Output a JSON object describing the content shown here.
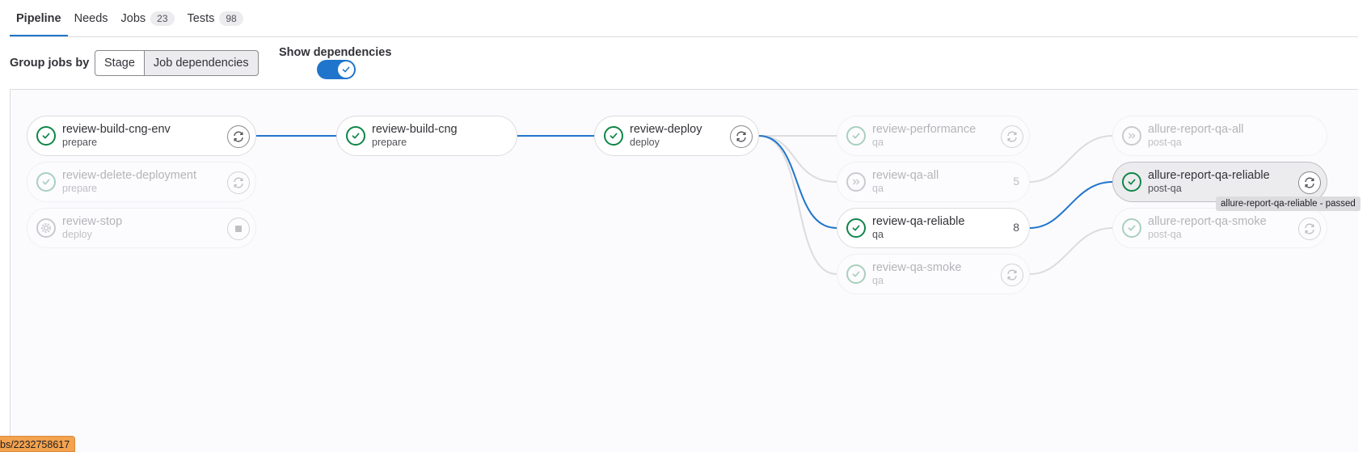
{
  "tabs": [
    {
      "label": "Pipeline",
      "badge": null
    },
    {
      "label": "Needs",
      "badge": null
    },
    {
      "label": "Jobs",
      "badge": "23"
    },
    {
      "label": "Tests",
      "badge": "98"
    }
  ],
  "controls": {
    "group_by_label": "Group jobs by",
    "group_by_options": [
      "Stage",
      "Job dependencies"
    ],
    "selected_group_by": "Job dependencies",
    "show_dependencies_label": "Show dependencies",
    "show_dependencies_on": true
  },
  "jobs": [
    {
      "name": "review-build-cng-env",
      "stage": "prepare",
      "status": "passed",
      "action": "retry-icon"
    },
    {
      "name": "review-delete-deployment",
      "stage": "prepare",
      "status": "passed",
      "action": "retry-icon"
    },
    {
      "name": "review-stop",
      "stage": "deploy",
      "status": "manual",
      "action": "stop-icon"
    },
    {
      "name": "review-build-cng",
      "stage": "prepare",
      "status": "passed",
      "action": null
    },
    {
      "name": "review-deploy",
      "stage": "deploy",
      "status": "passed",
      "action": "retry-icon"
    },
    {
      "name": "review-performance",
      "stage": "qa",
      "status": "passed",
      "action": "retry-icon"
    },
    {
      "name": "review-qa-all",
      "stage": "qa",
      "status": "skipped",
      "count": "5"
    },
    {
      "name": "review-qa-reliable",
      "stage": "qa",
      "status": "passed",
      "count": "8"
    },
    {
      "name": "review-qa-smoke",
      "stage": "qa",
      "status": "passed",
      "action": "retry-icon"
    },
    {
      "name": "allure-report-qa-all",
      "stage": "post-qa",
      "status": "skipped",
      "action": null
    },
    {
      "name": "allure-report-qa-reliable",
      "stage": "post-qa",
      "status": "passed",
      "action": "retry-icon"
    },
    {
      "name": "allure-report-qa-smoke",
      "stage": "post-qa",
      "status": "passed",
      "action": "retry-icon"
    }
  ],
  "tooltip": "allure-report-qa-reliable - passed",
  "status_url": "bs/2232758617",
  "colors": {
    "accent": "#1f75cb",
    "success": "#108548",
    "link_inactive": "#dcdcde"
  }
}
